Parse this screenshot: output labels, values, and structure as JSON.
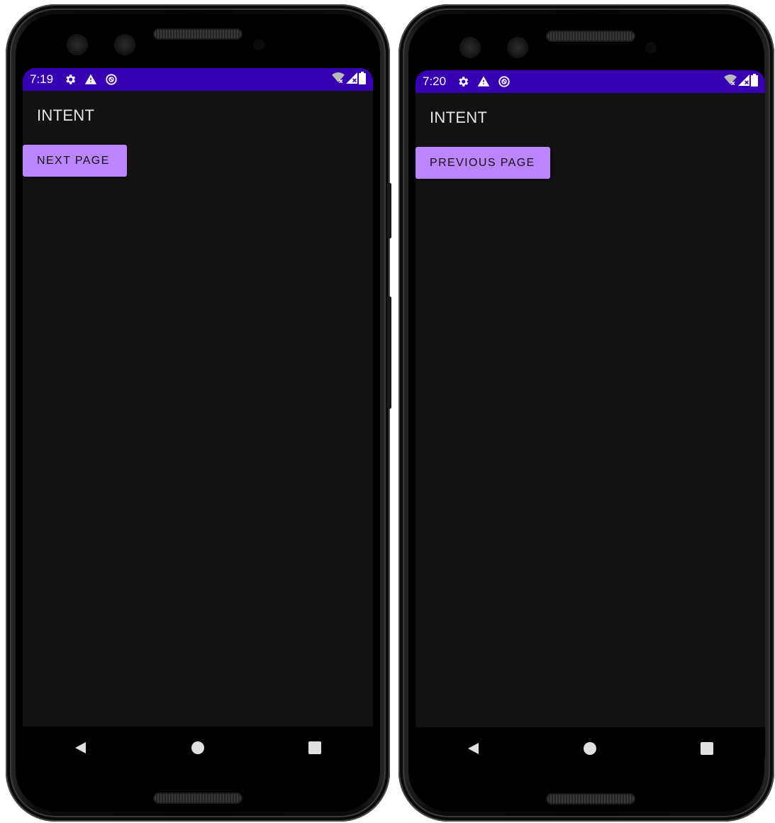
{
  "phones": [
    {
      "status": {
        "time": "7:19"
      },
      "app": {
        "title": "INTENT",
        "button_label": "NEXT PAGE"
      }
    },
    {
      "status": {
        "time": "7:20"
      },
      "app": {
        "title": "INTENT",
        "button_label": "PREVIOUS PAGE"
      }
    }
  ],
  "colors": {
    "status_bar": "#3700b3",
    "button": "#bb86fc",
    "screen_background": "#121212",
    "nav_bar": "#000000"
  },
  "icons": {
    "status_left": [
      "settings-gear-icon",
      "warning-icon",
      "sync-circle-icon"
    ],
    "status_right": [
      "wifi-off-icon",
      "cell-signal-off-icon",
      "battery-icon"
    ],
    "nav": [
      "back-triangle-icon",
      "home-circle-icon",
      "recents-square-icon"
    ]
  }
}
